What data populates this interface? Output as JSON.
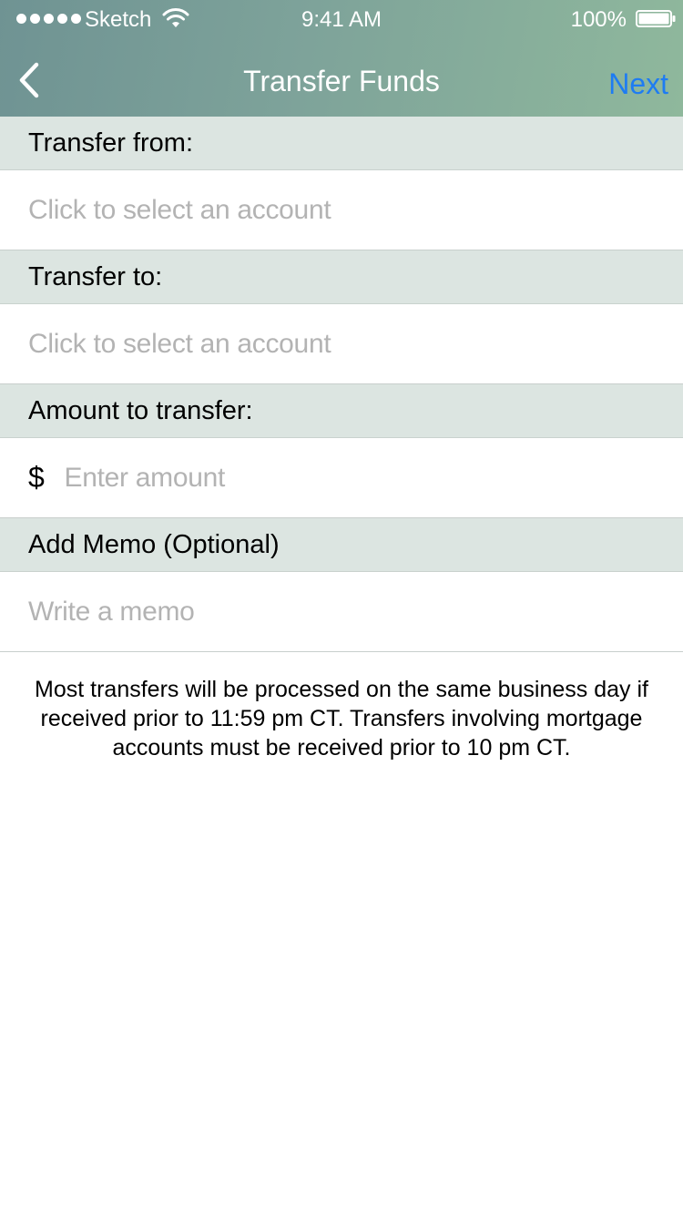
{
  "status_bar": {
    "carrier": "Sketch",
    "time": "9:41 AM",
    "battery": "100%"
  },
  "nav": {
    "title": "Transfer Funds",
    "back_icon": "chevron-left-icon",
    "next_label": "Next"
  },
  "form": {
    "from": {
      "header": "Transfer from:",
      "placeholder": "Click to select an account"
    },
    "to": {
      "header": "Transfer to:",
      "placeholder": "Click to select an account"
    },
    "amount": {
      "header": "Amount to transfer:",
      "currency": "$",
      "placeholder": "Enter amount"
    },
    "memo": {
      "header": "Add Memo (Optional)",
      "placeholder": "Write a memo"
    }
  },
  "notice": "Most transfers will be processed on the same business day if received prior to 11:59 pm CT. Transfers involving mortgage accounts must be received prior to 10 pm CT.",
  "colors": {
    "accent": "#1e7cf2",
    "section_bg": "#dce5e1",
    "placeholder": "#b3b3b3"
  }
}
